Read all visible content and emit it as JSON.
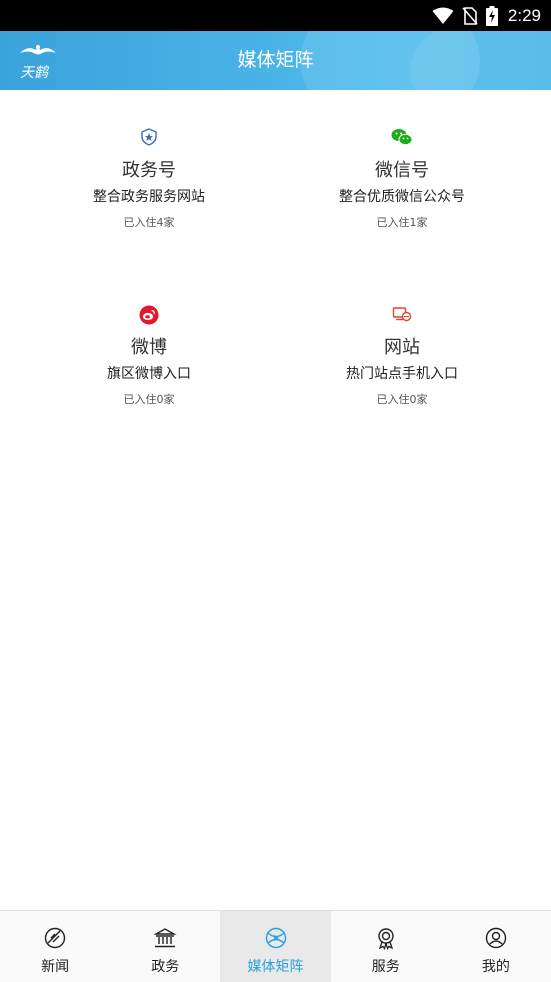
{
  "status_bar": {
    "time": "2:29"
  },
  "header": {
    "title": "媒体矩阵",
    "logo_text": "天鹤"
  },
  "cards": [
    {
      "title": "政务号",
      "desc": "整合政务服务网站",
      "count": "已入住4家",
      "icon": "police-badge-icon",
      "color": "#3b6fb6"
    },
    {
      "title": "微信号",
      "desc": "整合优质微信公众号",
      "count": "已入住1家",
      "icon": "wechat-icon",
      "color": "#1aad19"
    },
    {
      "title": "微博",
      "desc": "旗区微博入口",
      "count": "已入住0家",
      "icon": "weibo-icon",
      "color": "#e6162d"
    },
    {
      "title": "网站",
      "desc": "热门站点手机入口",
      "count": "已入住0家",
      "icon": "website-icon",
      "color": "#e8402f"
    }
  ],
  "tabs": [
    {
      "label": "新闻",
      "icon": "news-icon"
    },
    {
      "label": "政务",
      "icon": "government-icon"
    },
    {
      "label": "媒体矩阵",
      "icon": "media-matrix-icon",
      "active": true
    },
    {
      "label": "服务",
      "icon": "service-icon"
    },
    {
      "label": "我的",
      "icon": "profile-icon"
    }
  ],
  "colors": {
    "header": "#48b2e6",
    "active_tab": "#2a9fe2"
  }
}
